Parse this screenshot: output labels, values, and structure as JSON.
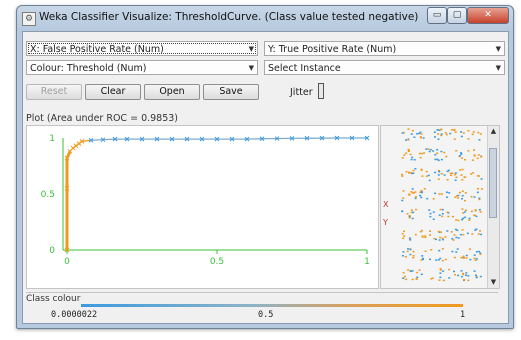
{
  "window": {
    "title": "Weka Classifier Visualize: ThresholdCurve. (Class value tested negative)",
    "minimize_label": "▭",
    "maximize_label": "▢",
    "close_label": "✕"
  },
  "controls": {
    "x_axis": "X: False Positive Rate (Num)",
    "y_axis": "Y: True Positive Rate (Num)",
    "colour": "Colour: Threshold (Num)",
    "select_instance": "Select Instance",
    "buttons": {
      "reset": "Reset",
      "clear": "Clear",
      "open": "Open",
      "save": "Save"
    },
    "jitter_label": "Jitter"
  },
  "plot": {
    "label": "Plot (Area under ROC = 0.9853)",
    "side_y_label": "Y",
    "side_x_label": "X"
  },
  "chart_data": {
    "type": "scatter",
    "title": "Plot (Area under ROC = 0.9853)",
    "xlabel": "",
    "ylabel": "",
    "xlim": [
      0,
      1
    ],
    "ylim": [
      0,
      1
    ],
    "x_ticks": [
      "0",
      "0.5",
      "1"
    ],
    "y_ticks": [
      "0",
      "0.5",
      "1"
    ],
    "series": [
      {
        "x": [
          0,
          0,
          0,
          0.01,
          0.02,
          0.03,
          0.04,
          0.05,
          0.08,
          0.12,
          0.16,
          0.2,
          0.25,
          0.3,
          0.35,
          0.4,
          0.45,
          0.5,
          0.55,
          0.6,
          0.65,
          0.7,
          0.75,
          0.8,
          0.85,
          0.9,
          0.95,
          1
        ],
        "y": [
          0,
          0.55,
          0.82,
          0.88,
          0.91,
          0.93,
          0.95,
          0.97,
          0.98,
          0.985,
          0.99,
          0.99,
          0.99,
          0.99,
          0.99,
          0.99,
          0.99,
          0.99,
          0.99,
          0.99,
          0.993,
          0.995,
          0.997,
          0.998,
          0.999,
          1,
          1,
          1
        ]
      }
    ],
    "colors": {
      "low": "#3b9be0",
      "high": "#f09a1d",
      "axis": "#38c238"
    }
  },
  "class_colour": {
    "title": "Class colour",
    "min": "0.0000022",
    "mid": "0.5",
    "max": "1"
  }
}
